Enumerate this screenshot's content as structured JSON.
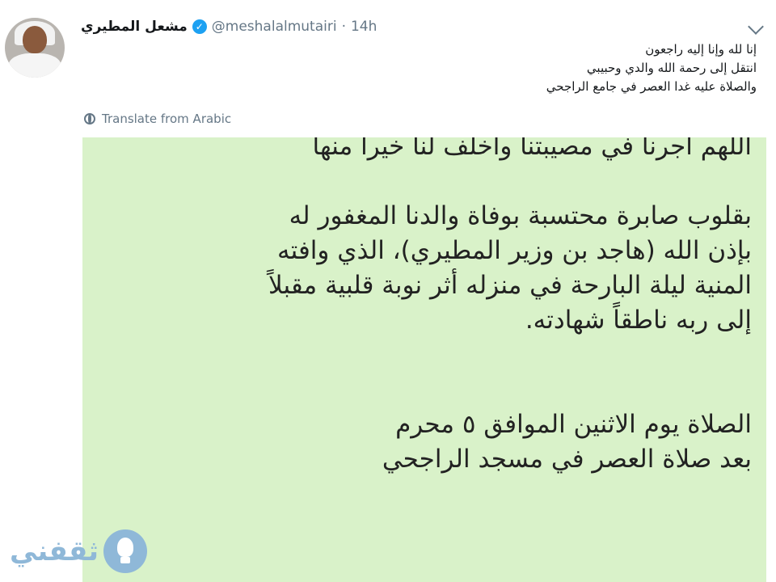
{
  "tweet": {
    "author_name": "مشعل المطيري",
    "handle": "@meshalalmutairi",
    "separator": "·",
    "time": "14h",
    "verified_mark": "✓",
    "lines": [
      "إنا لله وإنا إليه راجعون",
      "انتقل إلى رحمة الله والدي وحبيبي",
      "والصلاة عليه غدا العصر في جامع الراجحي"
    ],
    "translate_label": "Translate from Arabic",
    "icons": {
      "avatar": "avatar-photo",
      "verified": "verified-badge-icon",
      "menu": "chevron-down-icon",
      "translate": "globe-icon"
    }
  },
  "image_card": {
    "background": "#d9f2c9",
    "lines": [
      "اللهم اجرنا في مصيبتنا واخلف لنا خيرا منها",
      "",
      "بقلوب صابرة محتسبة بوفاة والدنا المغفور له",
      "بإذن الله (هاجد بن وزير المطيري)، الذي وافته",
      "المنية ليلة البارحة في منزله أثر نوبة قلبية مقبلاً",
      "إلى ربه ناطقاً شهادته.",
      "",
      "",
      "الصلاة  يوم الاثنين الموافق ٥ محرم",
      "بعد صلاة العصر في مسجد الراجحي"
    ]
  },
  "watermark": {
    "text": "ثقفني",
    "icon": "lightbulb-icon",
    "color": "#8fb8d8"
  }
}
